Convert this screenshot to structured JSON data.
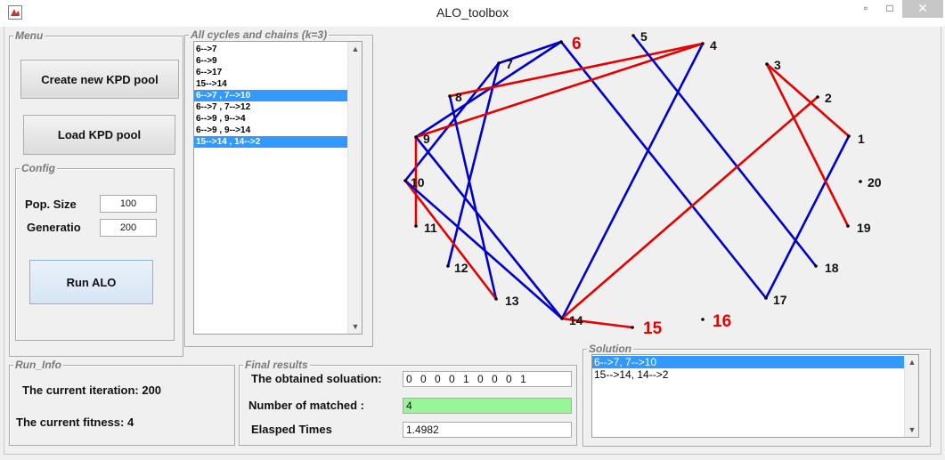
{
  "window": {
    "title": "ALO_toolbox",
    "minimize_glyph": "▫",
    "maximize_glyph": "□",
    "close_glyph": "✕"
  },
  "menu": {
    "legend": "Menu",
    "create_label": "Create new KPD pool",
    "load_label": "Load KPD pool"
  },
  "config": {
    "legend": "Config",
    "pop_label": "Pop. Size",
    "pop_value": "100",
    "gen_label": "Generatio",
    "gen_value": "200",
    "run_label": "Run ALO"
  },
  "cycles": {
    "legend": "All cycles and chains (k=3)",
    "items": [
      {
        "text": "6-->7",
        "selected": false
      },
      {
        "text": "6-->9",
        "selected": false
      },
      {
        "text": "6-->17",
        "selected": false
      },
      {
        "text": "15-->14",
        "selected": false
      },
      {
        "text": "6-->7  ,  7-->10",
        "selected": true
      },
      {
        "text": "6-->7  ,  7-->12",
        "selected": false
      },
      {
        "text": "6-->9  ,  9-->4",
        "selected": false
      },
      {
        "text": "6-->9  ,  9-->14",
        "selected": false
      },
      {
        "text": "15-->14  ,  14-->2",
        "selected": true
      }
    ]
  },
  "graph": {
    "colors": {
      "blue": "#0000cc",
      "red": "#e60000",
      "label": "#111111",
      "highlight": "#e60000"
    },
    "nodes": [
      {
        "id": "1",
        "highlight": false
      },
      {
        "id": "2",
        "highlight": false
      },
      {
        "id": "3",
        "highlight": false
      },
      {
        "id": "4",
        "highlight": false
      },
      {
        "id": "5",
        "highlight": false
      },
      {
        "id": "6",
        "highlight": true
      },
      {
        "id": "7",
        "highlight": false
      },
      {
        "id": "8",
        "highlight": false
      },
      {
        "id": "9",
        "highlight": false
      },
      {
        "id": "10",
        "highlight": false
      },
      {
        "id": "11",
        "highlight": false
      },
      {
        "id": "12",
        "highlight": false
      },
      {
        "id": "13",
        "highlight": false
      },
      {
        "id": "14",
        "highlight": false
      },
      {
        "id": "15",
        "highlight": true
      },
      {
        "id": "16",
        "highlight": true
      },
      {
        "id": "17",
        "highlight": false
      },
      {
        "id": "18",
        "highlight": false
      },
      {
        "id": "19",
        "highlight": false
      },
      {
        "id": "20",
        "highlight": false
      }
    ],
    "edges": [
      {
        "from": "6",
        "to": "7",
        "color": "blue"
      },
      {
        "from": "6",
        "to": "9",
        "color": "blue"
      },
      {
        "from": "6",
        "to": "17",
        "color": "blue"
      },
      {
        "from": "7",
        "to": "10",
        "color": "blue"
      },
      {
        "from": "7",
        "to": "12",
        "color": "blue"
      },
      {
        "from": "9",
        "to": "4",
        "color": "red"
      },
      {
        "from": "9",
        "to": "14",
        "color": "blue"
      },
      {
        "from": "9",
        "to": "11",
        "color": "red"
      },
      {
        "from": "8",
        "to": "4",
        "color": "red"
      },
      {
        "from": "8",
        "to": "13",
        "color": "blue"
      },
      {
        "from": "10",
        "to": "13",
        "color": "red"
      },
      {
        "from": "10",
        "to": "14",
        "color": "blue"
      },
      {
        "from": "4",
        "to": "14",
        "color": "blue"
      },
      {
        "from": "5",
        "to": "18",
        "color": "blue"
      },
      {
        "from": "1",
        "to": "17",
        "color": "blue"
      },
      {
        "from": "3",
        "to": "1",
        "color": "red"
      },
      {
        "from": "3",
        "to": "19",
        "color": "red"
      },
      {
        "from": "14",
        "to": "2",
        "color": "red"
      },
      {
        "from": "14",
        "to": "15",
        "color": "red"
      }
    ]
  },
  "run_info": {
    "legend": "Run_Info",
    "iteration_label": "The current iteration: 200",
    "fitness_label": "The current fitness: 4"
  },
  "final": {
    "legend": "Final results",
    "solution_label": "The obtained soluation:",
    "solution_value": "0 0 0 0 1 0 0 0 1",
    "matched_label": "Number of matched :",
    "matched_value": "4",
    "elapsed_label": "Elasped Times",
    "elapsed_value": "1.4982"
  },
  "solution": {
    "legend": "Solution",
    "items": [
      {
        "text": "6-->7, 7-->10",
        "selected": true
      },
      {
        "text": "15-->14, 14-->2",
        "selected": false
      }
    ]
  }
}
